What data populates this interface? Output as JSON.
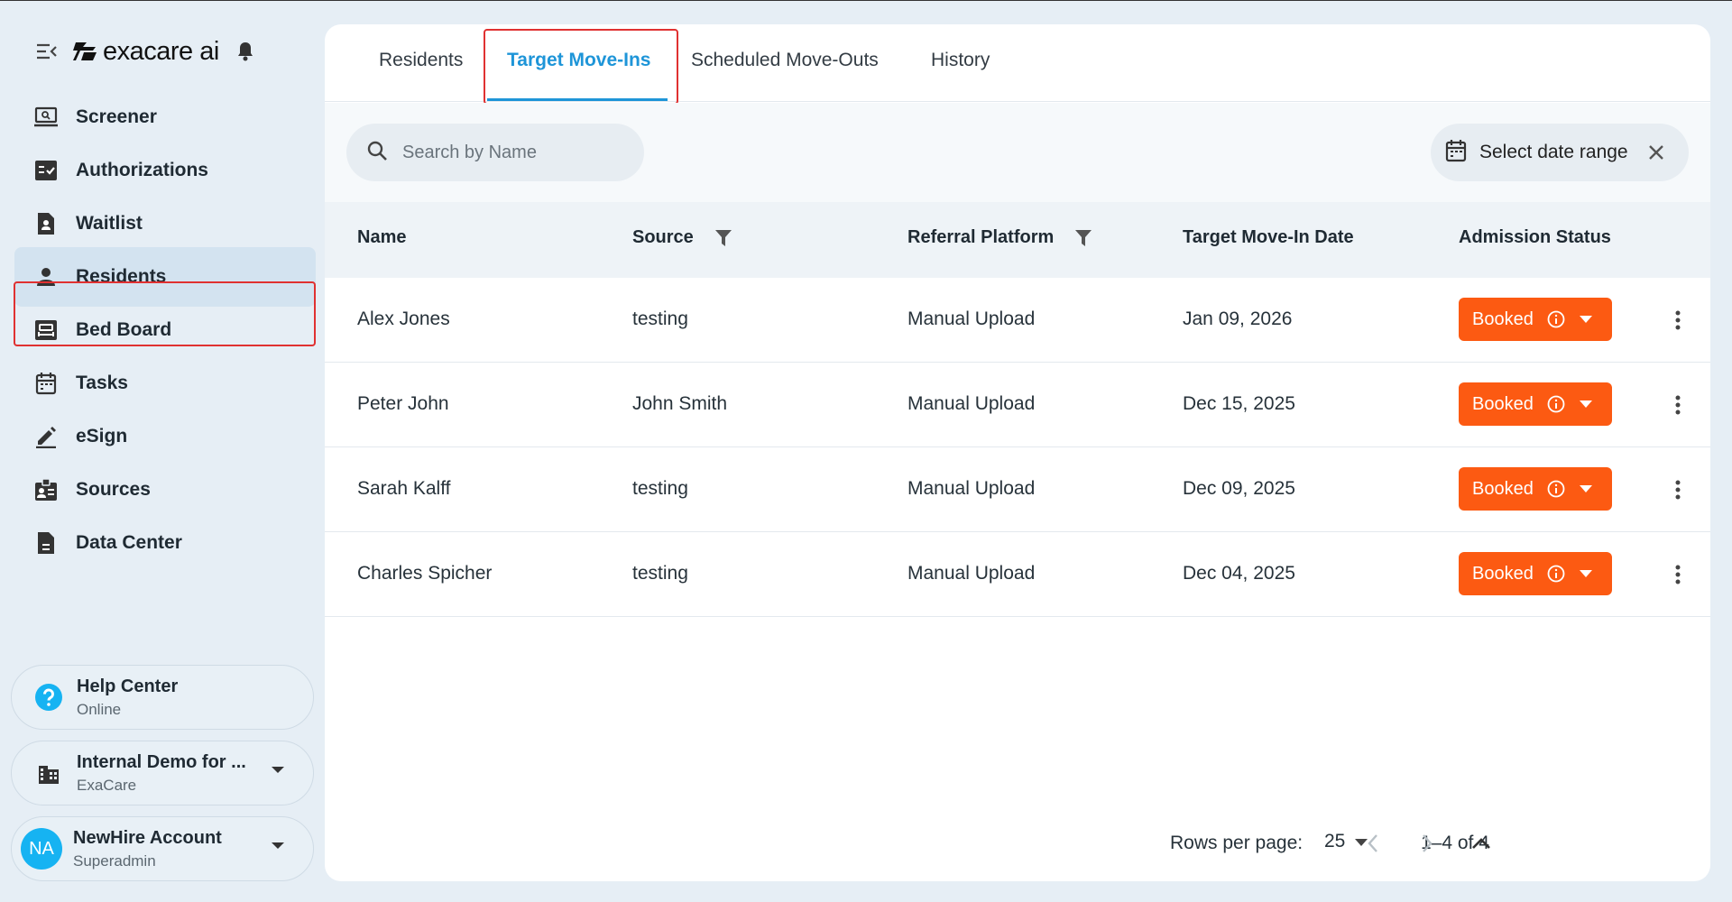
{
  "brand": {
    "name": "exacare ai"
  },
  "sidebar": {
    "items": [
      {
        "label": "Screener",
        "icon": "screener-icon"
      },
      {
        "label": "Authorizations",
        "icon": "authorizations-icon"
      },
      {
        "label": "Waitlist",
        "icon": "waitlist-icon"
      },
      {
        "label": "Residents",
        "icon": "person-icon",
        "active": true
      },
      {
        "label": "Bed Board",
        "icon": "bed-icon"
      },
      {
        "label": "Tasks",
        "icon": "calendar-icon"
      },
      {
        "label": "eSign",
        "icon": "pen-icon"
      },
      {
        "label": "Sources",
        "icon": "contact-badge-icon"
      },
      {
        "label": "Data Center",
        "icon": "document-icon"
      }
    ],
    "help": {
      "title": "Help Center",
      "status": "Online"
    },
    "facility": {
      "title": "Internal Demo for ...",
      "subtitle": "ExaCare"
    },
    "account": {
      "initials": "NA",
      "name": "NewHire Account",
      "role": "Superadmin"
    }
  },
  "tabs": [
    {
      "label": "Residents"
    },
    {
      "label": "Target Move-Ins",
      "active": true
    },
    {
      "label": "Scheduled Move-Outs"
    },
    {
      "label": "History"
    }
  ],
  "search": {
    "placeholder": "Search by Name",
    "value": ""
  },
  "date_range": {
    "label": "Select date range"
  },
  "table": {
    "columns": [
      "Name",
      "Source",
      "Referral Platform",
      "Target Move-In Date",
      "Admission Status"
    ],
    "rows": [
      {
        "name": "Alex Jones",
        "source": "testing",
        "platform": "Manual Upload",
        "date": "Jan 09, 2026",
        "status": "Booked"
      },
      {
        "name": "Peter John",
        "source": "John Smith",
        "platform": "Manual Upload",
        "date": "Dec 15, 2025",
        "status": "Booked"
      },
      {
        "name": "Sarah Kalff",
        "source": "testing",
        "platform": "Manual Upload",
        "date": "Dec 09, 2025",
        "status": "Booked"
      },
      {
        "name": "Charles Spicher",
        "source": "testing",
        "platform": "Manual Upload",
        "date": "Dec 04, 2025",
        "status": "Booked"
      }
    ]
  },
  "pagination": {
    "rows_per_page_label": "Rows per page:",
    "rows_per_page": "25",
    "range": "1–4 of 4"
  },
  "colors": {
    "accent": "#1e95d8",
    "status_booked": "#fc5a12",
    "highlight": "#e03131",
    "avatar": "#16b3f2"
  }
}
